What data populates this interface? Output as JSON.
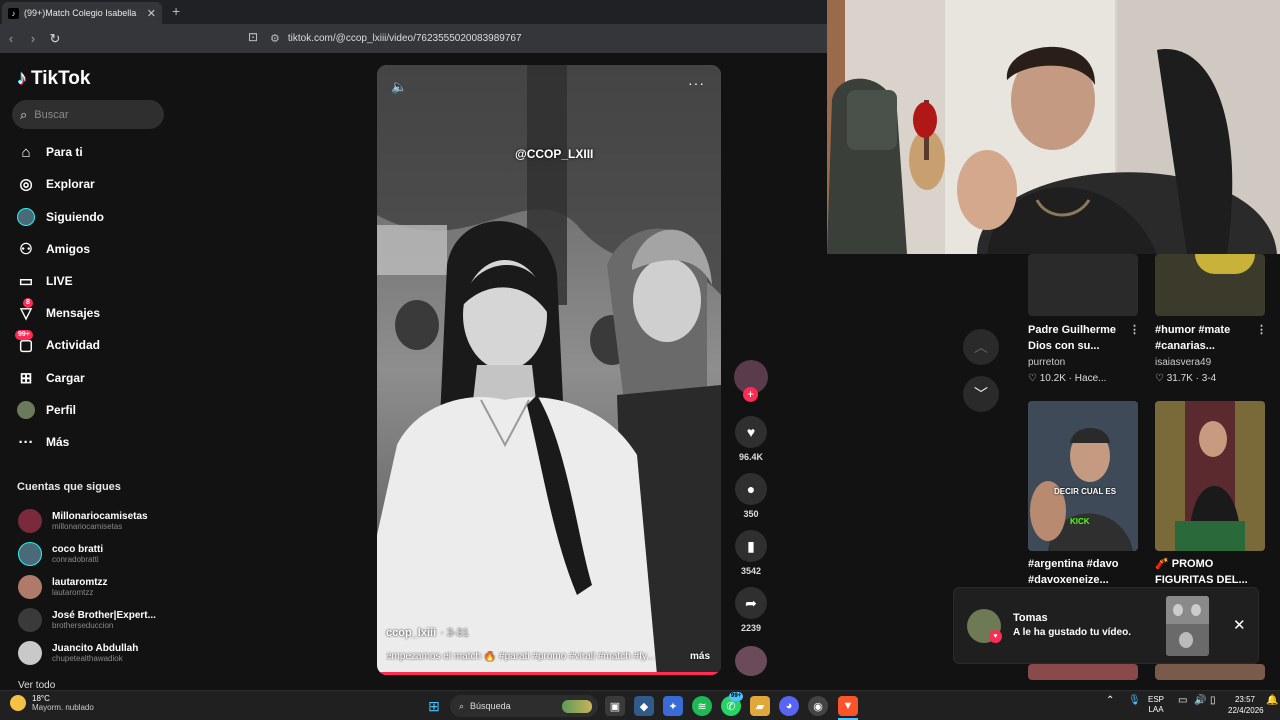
{
  "browser": {
    "tab_title": "(99+)Match Colegio Isabella",
    "url": "tiktok.com/@ccop_lxiii/video/7623555020083989767"
  },
  "sidebar": {
    "logo": "TikTok",
    "search_placeholder": "Buscar",
    "nav": [
      {
        "label": "Para ti",
        "icon": "home-icon"
      },
      {
        "label": "Explorar",
        "icon": "compass-icon"
      },
      {
        "label": "Siguiendo",
        "icon": "following-avatar"
      },
      {
        "label": "Amigos",
        "icon": "friends-icon"
      },
      {
        "label": "LIVE",
        "icon": "live-icon"
      },
      {
        "label": "Mensajes",
        "icon": "messages-icon",
        "badge": "8"
      },
      {
        "label": "Actividad",
        "icon": "activity-icon",
        "badge": "99+"
      },
      {
        "label": "Cargar",
        "icon": "upload-icon"
      },
      {
        "label": "Perfil",
        "icon": "profile-avatar"
      },
      {
        "label": "Más",
        "icon": "more-icon"
      }
    ],
    "following_title": "Cuentas que sigues",
    "following": [
      {
        "name": "Millonariocamisetas",
        "handle": "millonariocamisetas"
      },
      {
        "name": "coco bratti",
        "handle": "conradobratti"
      },
      {
        "name": "lautaromtzz",
        "handle": "lautaromtzz"
      },
      {
        "name": "José Brother|Expert...",
        "handle": "brotherseduccion"
      },
      {
        "name": "Juancito Abdullah",
        "handle": "chupetealthawadiok"
      }
    ],
    "see_all": "Ver todo"
  },
  "video": {
    "overlay_text": "@CCOP_LXIII",
    "author": "ccop_lxiii",
    "date": "· 3-31",
    "caption": "empezamos el match 🔥 #parati #promo #virall #match #fy...",
    "more": "más",
    "progress": 1.0
  },
  "actions": {
    "likes": "96.4K",
    "comments": "350",
    "saves": "3542",
    "shares": "2239"
  },
  "recommendations": [
    {
      "title_line1": "Padre Guilherme",
      "title_line2": "Dios con su...",
      "author": "purreton",
      "likes": "10.2K",
      "extra": "· Hace..."
    },
    {
      "title_line1": "#humor #mate",
      "title_line2": "#canarias...",
      "author": "isaiasvera49",
      "likes": "31.7K",
      "extra": "· 3-4"
    },
    {
      "title_line1": "#argentina #davo",
      "title_line2": "#davoxeneize...",
      "thumb_text_1": "DECIR CUAL ES",
      "thumb_text_2": "KICK"
    },
    {
      "title_line1": "🧨 PROMO",
      "title_line2": "FIGURITAS DEL..."
    }
  ],
  "toast": {
    "name": "Tomas",
    "message": "A le ha gustado tu vídeo."
  },
  "taskbar": {
    "temp": "18°C",
    "weather": "Mayorm. nublado",
    "search": "Búsqueda",
    "lang1": "ESP",
    "lang2": "LAA",
    "time": "23:57",
    "date": "22/4/2026",
    "badge": "99+"
  },
  "colors": {
    "accent": "#fe2c55",
    "background": "#121212",
    "taskbar": "#202020"
  }
}
